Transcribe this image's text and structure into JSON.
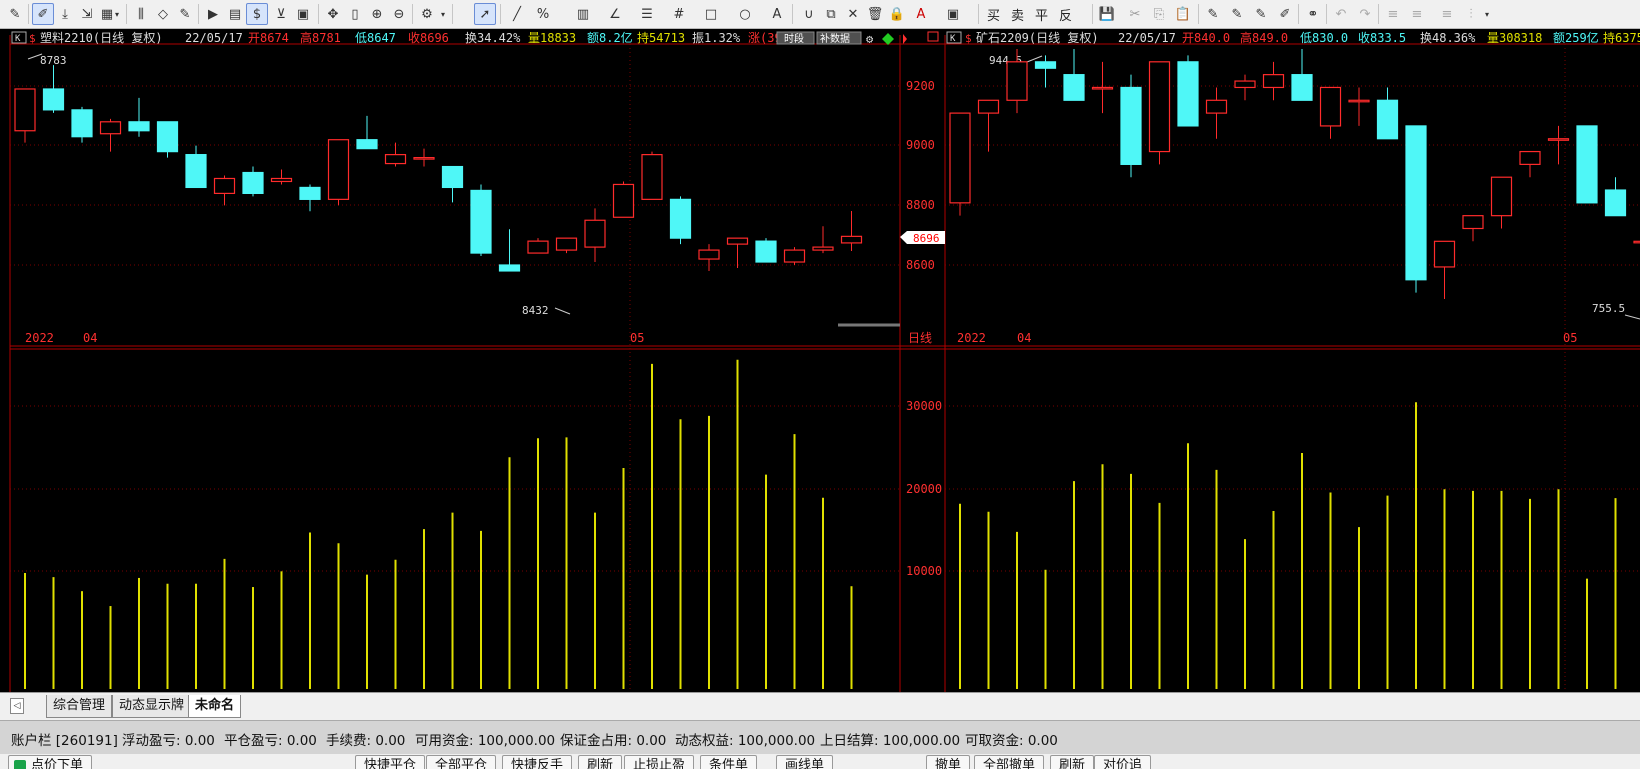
{
  "toolbar": {
    "right_labels": [
      "买",
      "卖",
      "平",
      "反"
    ]
  },
  "charts": [
    {
      "header": {
        "symbol": "塑料2210(日线 复权)",
        "date": "22/05/17",
        "open": "开8674",
        "high": "高8781",
        "low": "低8647",
        "close": "收8696",
        "turnover": "换34.42%",
        "volume": "量18833",
        "amount": "额8.2亿",
        "position": "持54713",
        "amplitude": "振1.32%",
        "change": "涨(39",
        "period_btn": "时段",
        "fill_btn": "补数据"
      },
      "high_label": "8783",
      "low_label": "8432",
      "current_price": "8696",
      "price_ticks": [
        "9200",
        "9000",
        "8800",
        "8600"
      ],
      "date_labels": [
        "2022",
        "04",
        "05"
      ],
      "period_label": "日线",
      "volume_ticks": [
        "30000",
        "20000",
        "10000"
      ]
    },
    {
      "header": {
        "symbol": "矿石2209(日线 复权)",
        "date": "22/05/17",
        "open": "开840.0",
        "high": "高849.0",
        "low": "低830.0",
        "close": "收833.5",
        "turnover": "换48.36%",
        "volume": "量308318",
        "amount": "额259亿",
        "position": "持6375"
      },
      "high_label": "944.5",
      "low_label": "755.5",
      "date_labels": [
        "2022",
        "04",
        "05"
      ]
    }
  ],
  "chart_data": [
    {
      "type": "candlestick",
      "series_name": "塑料2210",
      "ohlc": [
        [
          9050,
          9190,
          9010,
          9190
        ],
        [
          9190,
          9270,
          9110,
          9120
        ],
        [
          9120,
          9130,
          9010,
          9030
        ],
        [
          9040,
          9090,
          8980,
          9080
        ],
        [
          9080,
          9160,
          9030,
          9050
        ],
        [
          9080,
          9080,
          8960,
          8980
        ],
        [
          8970,
          9000,
          8860,
          8860
        ],
        [
          8840,
          8900,
          8800,
          8890
        ],
        [
          8910,
          8930,
          8830,
          8840
        ],
        [
          8880,
          8920,
          8870,
          8890
        ],
        [
          8860,
          8870,
          8780,
          8820
        ],
        [
          8820,
          9020,
          8800,
          9020
        ],
        [
          9020,
          9100,
          9010,
          8990
        ],
        [
          8940,
          9010,
          8930,
          8970
        ],
        [
          8960,
          8990,
          8930,
          8960
        ],
        [
          8930,
          8930,
          8810,
          8860
        ],
        [
          8850,
          8870,
          8630,
          8640
        ],
        [
          8600,
          8720,
          8590,
          8580
        ],
        [
          8640,
          8690,
          8640,
          8680
        ],
        [
          8650,
          8690,
          8640,
          8690
        ],
        [
          8660,
          8790,
          8610,
          8750
        ],
        [
          8760,
          8880,
          8760,
          8870
        ],
        [
          8820,
          8980,
          8820,
          8970
        ],
        [
          8820,
          8830,
          8670,
          8690
        ],
        [
          8620,
          8670,
          8580,
          8650
        ],
        [
          8670,
          8680,
          8590,
          8690
        ],
        [
          8680,
          8690,
          8610,
          8610
        ],
        [
          8610,
          8660,
          8600,
          8650
        ],
        [
          8650,
          8730,
          8640,
          8660
        ],
        [
          8674,
          8781,
          8647,
          8696
        ]
      ],
      "volume": [
        9800,
        9300,
        7600,
        5800,
        9200,
        8500,
        8500,
        11500,
        8100,
        10000,
        14700,
        13400,
        9600,
        11400,
        15100,
        17100,
        14900,
        23800,
        26100,
        26200,
        17100,
        22500,
        35100,
        28400,
        28800,
        35600,
        21700,
        26600,
        18900,
        8200
      ],
      "y_ticks": [
        9200,
        9000,
        8800,
        8600
      ],
      "volume_ticks": [
        30000,
        20000,
        10000
      ],
      "annotations": {
        "max": 8783,
        "min": 8432,
        "last": 8696
      }
    },
    {
      "type": "candlestick",
      "series_name": "矿石2209",
      "ohlc": [
        [
          830,
          900,
          820,
          900
        ],
        [
          900,
          910,
          870,
          910
        ],
        [
          910,
          950,
          900,
          940
        ],
        [
          940,
          945,
          920,
          935
        ],
        [
          930,
          950,
          910,
          910
        ],
        [
          920,
          940,
          900,
          920
        ],
        [
          920,
          930,
          850,
          860
        ],
        [
          870,
          940,
          860,
          940
        ],
        [
          940,
          945,
          890,
          890
        ],
        [
          900,
          920,
          880,
          910
        ],
        [
          920,
          930,
          910,
          925
        ],
        [
          920,
          940,
          910,
          930
        ],
        [
          930,
          950,
          910,
          910
        ],
        [
          890,
          920,
          880,
          920
        ],
        [
          910,
          920,
          890,
          910
        ],
        [
          910,
          920,
          880,
          880
        ],
        [
          890,
          890,
          760,
          770
        ],
        [
          780,
          800,
          755,
          800
        ],
        [
          810,
          820,
          800,
          820
        ],
        [
          820,
          850,
          810,
          850
        ],
        [
          860,
          870,
          850,
          870
        ],
        [
          880,
          890,
          860,
          880
        ],
        [
          890,
          890,
          830,
          830
        ],
        [
          840,
          850,
          820,
          820
        ],
        [
          800,
          810,
          790,
          800
        ]
      ],
      "volume": [
        23000,
        22000,
        19500,
        14800,
        25800,
        27900,
        26700,
        23100,
        30500,
        27200,
        18600,
        22100,
        29300,
        24400,
        20100,
        24000,
        35600,
        24800,
        24600,
        24600,
        23600,
        24800,
        13700,
        23700,
        26800
      ]
    }
  ],
  "tabs": [
    "综合管理",
    "动态显示牌",
    "未命名"
  ],
  "account": {
    "items": [
      "账户栏 [260191]",
      "浮动盈亏: 0.00",
      "平仓盈亏: 0.00",
      "手续费: 0.00",
      "可用资金: 100,000.00",
      "保证金占用: 0.00",
      "动态权益: 100,000.00",
      "上日结算: 100,000.00",
      "可取资金: 0.00"
    ]
  },
  "bottom_buttons": {
    "left": "点价下单",
    "actions": [
      "快捷平仓",
      "全部平仓",
      "快捷反手",
      "刷新",
      "止损止盈",
      "条件单",
      "画线单"
    ],
    "right": [
      "撤单",
      "全部撤单",
      "刷新",
      "对价追"
    ]
  },
  "colors": {
    "up": "#ff2b2b",
    "down": "#4ff7f7",
    "volume": "#e0e000",
    "grid": "#8b0000",
    "axis": "#b00000"
  }
}
